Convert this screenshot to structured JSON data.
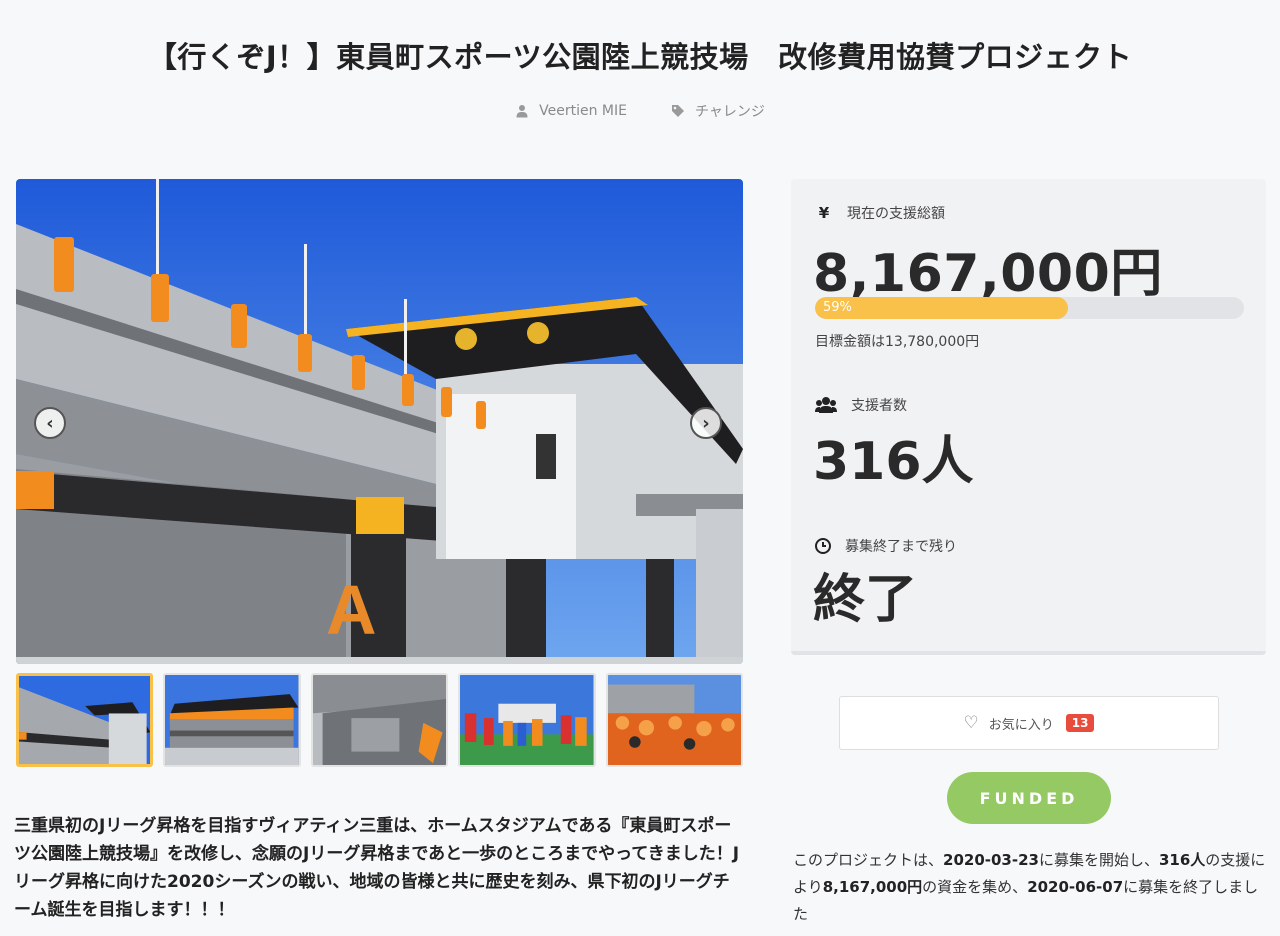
{
  "project": {
    "title": "【行くぞJ！】東員町スポーツ公園陸上競技場　改修費用協賛プロジェクト",
    "author": "Veertien MIE",
    "category": "チャレンジ"
  },
  "gallery": {
    "prev_icon": "chevron-left-icon",
    "next_icon": "chevron-right-icon",
    "thumbnail_count": 5,
    "active_thumbnail": 1
  },
  "description": "三重県初のJリーグ昇格を目指すヴィアティン三重は、ホームスタジアムである『東員町スポーツ公園陸上競技場』を改修し、念願のJリーグ昇格まであと一歩のところまでやってきました！Jリーグ昇格に向けた2020シーズンの戦い、地域の皆様と共に歴史を刻み、県下初のJリーグチーム誕生を目指します！！！",
  "stats": {
    "amount_label": "現在の支援総額",
    "amount_icon": "¥",
    "amount": "8,167,000円",
    "progress_percent": 59,
    "progress_label": "59%",
    "goal_text": "目標金額は13,780,000円",
    "backers_label": "支援者数",
    "backers": "316人",
    "remaining_label": "募集終了まで残り",
    "remaining": "終了"
  },
  "favorite": {
    "label": "お気に入り",
    "count": "13"
  },
  "status_badge": "FUNDED",
  "summary": {
    "p1": "このプロジェクトは、",
    "start_date": "2020-03-23",
    "p2": "に募集を開始し、",
    "backers": "316人",
    "p3": "の支援により",
    "amount": "8,167,000円",
    "p4": "の資金を集め、",
    "end_date": "2020-06-07",
    "p5": "に募集を終了しました"
  },
  "colors": {
    "accent": "#f9c04a",
    "funded": "#94c963",
    "badge": "#e74c3c"
  }
}
